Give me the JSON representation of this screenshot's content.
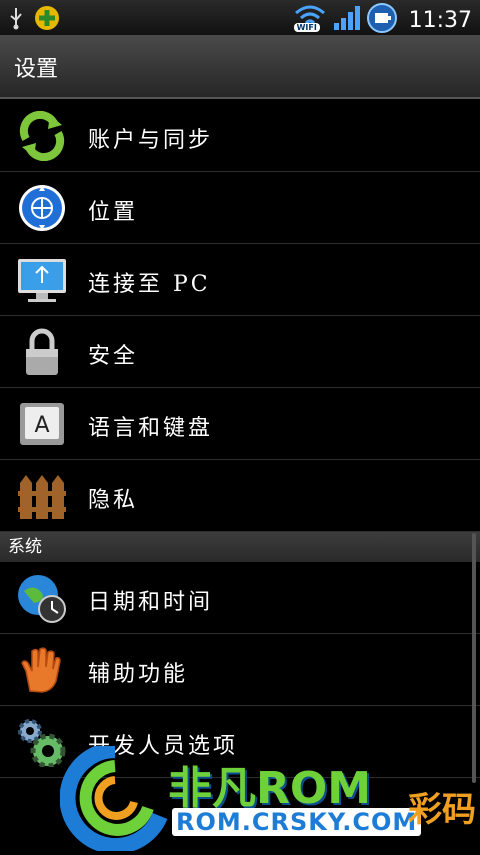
{
  "status_bar": {
    "time": "11:37",
    "wifi_label": "WIFI",
    "icons": [
      "usb-icon",
      "app-notification-icon",
      "wifi-icon",
      "signal-icon",
      "battery-icon"
    ]
  },
  "header": {
    "title": "设置"
  },
  "items": [
    {
      "label": "账户与同步",
      "icon": "sync-icon"
    },
    {
      "label": "位置",
      "icon": "location-globe-icon"
    },
    {
      "label": "连接至 PC",
      "icon": "pc-monitor-icon"
    },
    {
      "label": "安全",
      "icon": "lock-icon"
    },
    {
      "label": "语言和键盘",
      "icon": "keyboard-key-icon"
    },
    {
      "label": "隐私",
      "icon": "fence-icon"
    }
  ],
  "section_system": "系统",
  "system_items": [
    {
      "label": "日期和时间",
      "icon": "globe-clock-icon"
    },
    {
      "label": "辅助功能",
      "icon": "hand-icon"
    },
    {
      "label": "开发人员选项",
      "icon": "gears-icon"
    }
  ],
  "watermark": {
    "brand": "非凡ROM",
    "site": "ROM.CRSKY.COM",
    "side_text": "彩码"
  },
  "colors": {
    "background": "#000000",
    "accent_green": "#6fd13a",
    "accent_blue": "#1d7dd6"
  }
}
